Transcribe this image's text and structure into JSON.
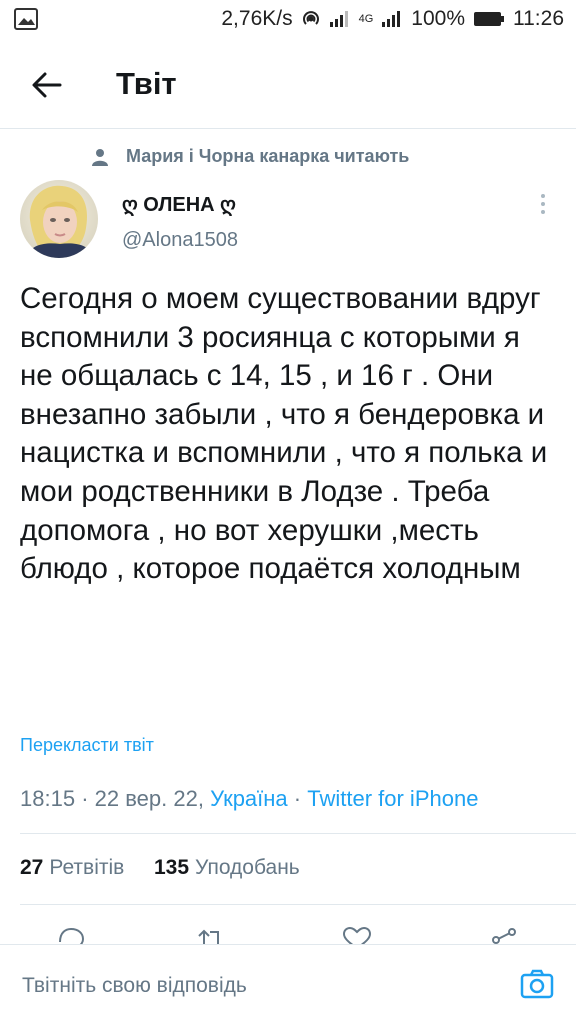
{
  "status": {
    "speed": "2,76K/s",
    "network": "4G",
    "battery": "100%",
    "time": "11:26"
  },
  "header": {
    "title": "Твіт"
  },
  "social_context": "Мария і Чорна канарка читають",
  "author": {
    "name": "ღ ОЛЕНА ღ",
    "handle": "@Alona1508"
  },
  "tweet": {
    "text": "Сегодня о моем существовании вдруг вспомнили 3 росиянца с которыми я не общалась с 14, 15 , и 16 г . Они внезапно забыли , что я бендеровка и нацистка и вспомнили , что я полька и мои родственники в Лодзе . Треба допомога , но вот херушки ,месть блюдо , которое подаётся холодным",
    "translate_label": "Перекласти твіт",
    "time": "18:15",
    "date": "22 вер. 22,",
    "location": "Україна",
    "source": "Twitter for iPhone",
    "separator": "·"
  },
  "stats": {
    "retweets_count": "27",
    "retweets_label": "Ретвітів",
    "likes_count": "135",
    "likes_label": "Уподобань"
  },
  "reply": {
    "placeholder": "Твітніть свою відповідь"
  },
  "colors": {
    "accent": "#1da1f2",
    "muted": "#657786",
    "text": "#14171a",
    "border": "#e1e8ed"
  }
}
